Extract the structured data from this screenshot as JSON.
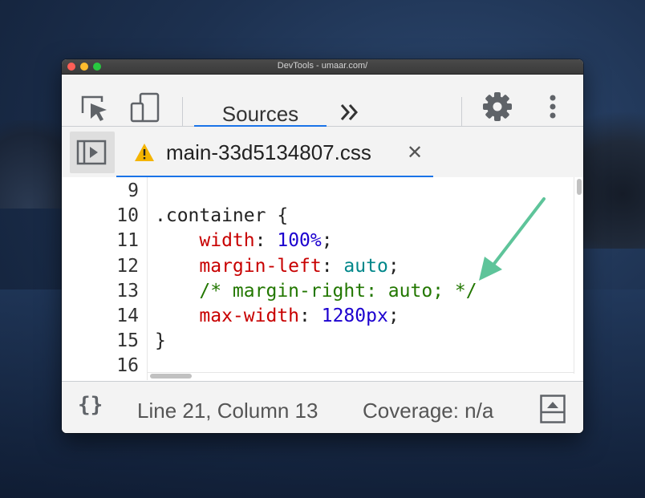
{
  "window": {
    "title": "DevTools - umaar.com/"
  },
  "toolbar": {
    "inspect_icon": "element-picker-icon",
    "device_icon": "device-toggle-icon",
    "active_tab": "Sources",
    "more_tabs_icon": "chevron-double-right-icon",
    "settings_icon": "gear-icon",
    "menu_icon": "vertical-dots-icon"
  },
  "file_tab": {
    "warning_icon": "warning-icon",
    "filename": "main-33d5134807.css",
    "close_label": "✕",
    "navigator_toggle_icon": "show-navigator-icon"
  },
  "editor": {
    "lines": [
      {
        "n": "9",
        "text": ""
      },
      {
        "n": "10",
        "text": ".container {"
      },
      {
        "n": "11",
        "prop": "width",
        "sep": ": ",
        "value": "100%",
        "end": ";"
      },
      {
        "n": "12",
        "prop": "margin-left",
        "sep": ": ",
        "value": "auto",
        "end": ";"
      },
      {
        "n": "13",
        "comment": "/* margin-right: auto; */"
      },
      {
        "n": "14",
        "prop": "max-width",
        "sep": ": ",
        "value": "1280px",
        "end": ";"
      },
      {
        "n": "15",
        "text": "}"
      },
      {
        "n": "16",
        "text": ""
      }
    ],
    "indent": "    "
  },
  "status": {
    "braces": "{}",
    "position": "Line 21, Column 13",
    "coverage": "Coverage: n/a",
    "drawer_icon": "toggle-drawer-icon"
  },
  "colors": {
    "accent": "#1a73e8",
    "property": "#c80000",
    "number": "#1c00cf",
    "keyword": "#00878a",
    "comment": "#227700",
    "annotation_arrow": "#5ec49a"
  }
}
